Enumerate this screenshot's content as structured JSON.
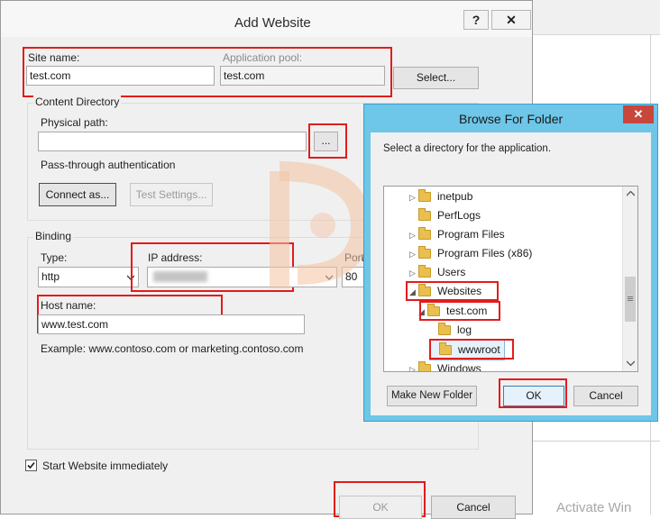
{
  "background_window": {
    "watermark_text": "Activate Win"
  },
  "add_website": {
    "title": "Add Website",
    "help_glyph": "?",
    "close_glyph": "✕",
    "site_name_label": "Site name:",
    "site_name_value": "test.com",
    "app_pool_label": "Application pool:",
    "app_pool_value": "test.com",
    "select_button": "Select...",
    "content_directory_label": "Content Directory",
    "physical_path_label": "Physical path:",
    "physical_path_value": "",
    "browse_button": "...",
    "pass_through_label": "Pass-through authentication",
    "connect_as_button": "Connect as...",
    "test_settings_button": "Test Settings...",
    "binding_label": "Binding",
    "type_label": "Type:",
    "type_value": "http",
    "ip_label": "IP address:",
    "ip_value": "",
    "port_label": "Port:",
    "port_value": "80",
    "host_name_label": "Host name:",
    "host_name_value": "www.test.com",
    "example_text": "Example: www.contoso.com or marketing.contoso.com",
    "start_immediately_label": "Start Website immediately",
    "start_immediately_checked": true,
    "ok_button": "OK",
    "cancel_button": "Cancel"
  },
  "browse_dialog": {
    "title": "Browse For Folder",
    "close_glyph": "✕",
    "instruction": "Select a directory for the application.",
    "tree": [
      {
        "name": "inetpub",
        "arrow": "▷"
      },
      {
        "name": "PerfLogs",
        "arrow": ""
      },
      {
        "name": "Program Files",
        "arrow": "▷"
      },
      {
        "name": "Program Files (x86)",
        "arrow": "▷"
      },
      {
        "name": "Users",
        "arrow": "▷"
      },
      {
        "name": "Websites",
        "arrow": "◢"
      },
      {
        "name": "test.com",
        "arrow": "◢"
      },
      {
        "name": "log",
        "arrow": ""
      },
      {
        "name": "wwwroot",
        "arrow": ""
      },
      {
        "name": "Windows",
        "arrow": "▷"
      }
    ],
    "make_new_folder_button": "Make New Folder",
    "ok_button": "OK",
    "cancel_button": "Cancel"
  },
  "colors": {
    "highlight_red": "#e21c1c",
    "browse_frame": "#6ec6e8"
  }
}
